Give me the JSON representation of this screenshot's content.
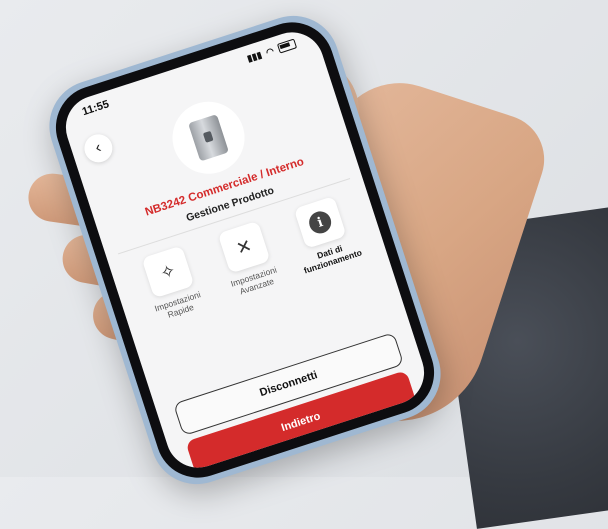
{
  "status_bar": {
    "time": "11:55",
    "signal": "▮▮▮",
    "wifi": "◠"
  },
  "header": {
    "back_glyph": "‹",
    "product_name": "NB3242 Commerciale / Interno",
    "section_title": "Gestione Prodotto"
  },
  "menu": {
    "items": [
      {
        "label": "Impostazioni Rapide",
        "icon": "wand-icon",
        "glyph": "✧"
      },
      {
        "label": "Impostazioni Avanzate",
        "icon": "tools-icon",
        "glyph": "✕"
      },
      {
        "label": "Dati di funzionamento",
        "icon": "info-icon",
        "glyph": "i"
      }
    ]
  },
  "buttons": {
    "disconnect": "Disconnetti",
    "back": "Indietro"
  },
  "colors": {
    "accent": "#d42b2b",
    "phone_frame": "#9fb8d2"
  }
}
